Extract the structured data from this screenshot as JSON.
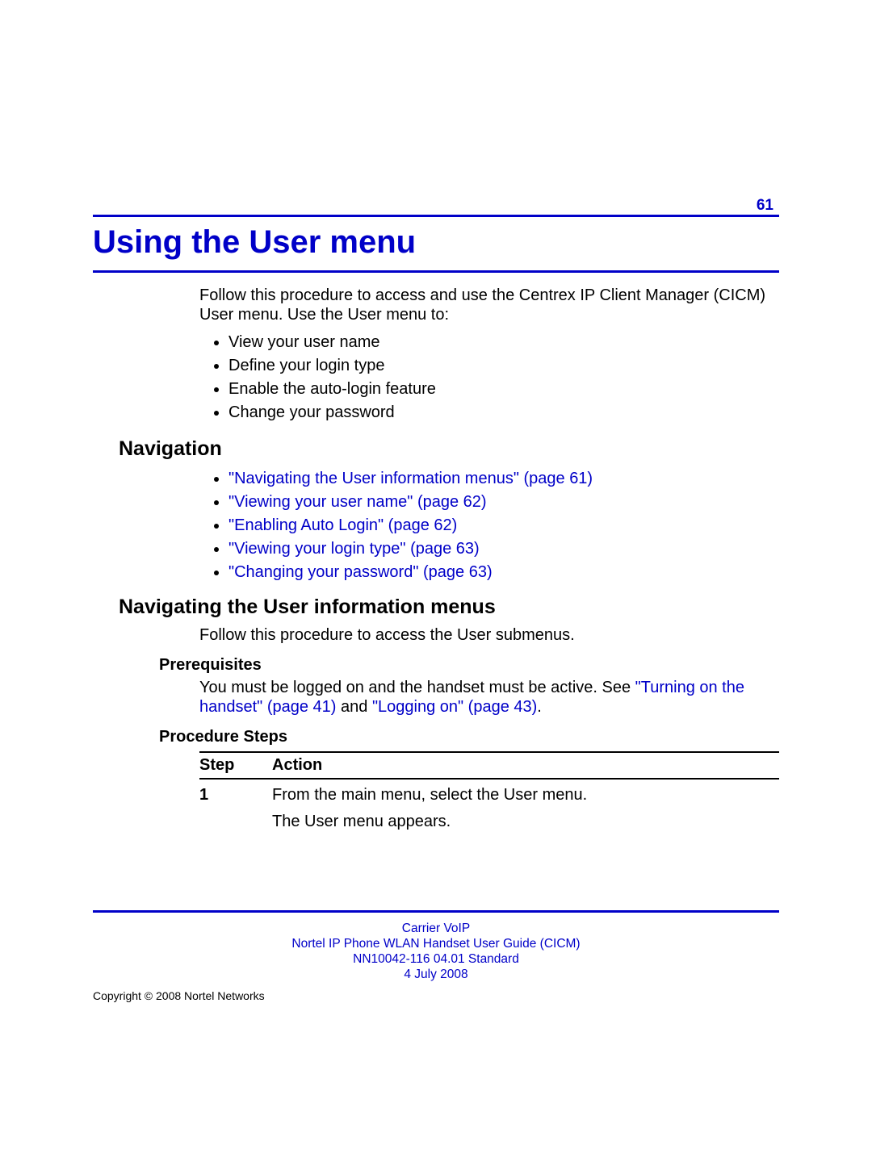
{
  "page_number": "61",
  "title": "Using the User menu",
  "intro": "Follow this procedure to access and use the Centrex IP Client Manager (CICM) User menu. Use the User menu to:",
  "intro_bullets": [
    "View your user name",
    "Define your login type",
    "Enable the auto-login feature",
    "Change your password"
  ],
  "sections": {
    "navigation": {
      "heading": "Navigation",
      "links": [
        "\"Navigating the User information menus\" (page 61)",
        "\"Viewing your user name\" (page 62)",
        "\"Enabling Auto Login\" (page 62)",
        "\"Viewing your login type\" (page 63)",
        "\"Changing your password\" (page 63)"
      ]
    },
    "navigating": {
      "heading": "Navigating the User information menus",
      "body": "Follow this procedure to access the User submenus.",
      "prereq_heading": "Prerequisites",
      "prereq_text_1": "You must be logged on and the handset must be active. See ",
      "prereq_link_1": "\"Turning on the handset\" (page 41)",
      "prereq_text_2": " and ",
      "prereq_link_2": "\"Logging on\" (page 43)",
      "prereq_text_3": ".",
      "procedure_heading": "Procedure Steps",
      "table": {
        "head_step": "Step",
        "head_action": "Action",
        "rows": [
          {
            "step": "1",
            "action_line1": "From the main menu, select the User menu.",
            "action_line2": "The User menu appears."
          }
        ]
      }
    }
  },
  "footer": {
    "line1": "Carrier VoIP",
    "line2": "Nortel IP Phone WLAN Handset User Guide (CICM)",
    "line3": "NN10042-116   04.01   Standard",
    "line4": "4 July 2008"
  },
  "copyright": "Copyright © 2008 Nortel Networks"
}
